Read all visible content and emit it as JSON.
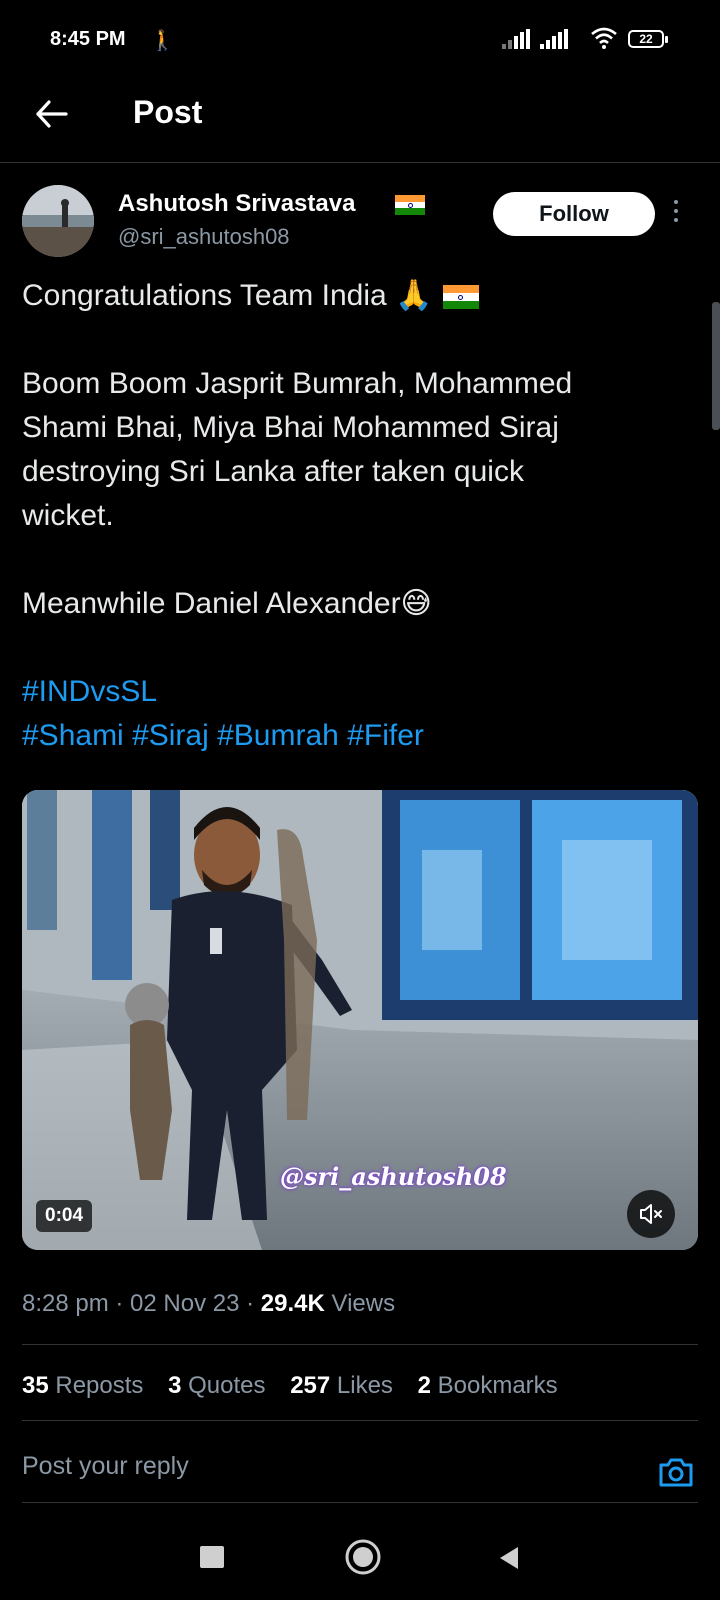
{
  "status_bar": {
    "time": "8:45 PM",
    "battery": "22",
    "icons": [
      "walking-icon",
      "signal-icon",
      "signal-icon",
      "wifi-icon",
      "battery-icon"
    ]
  },
  "header": {
    "title": "Post",
    "back_icon": "arrow-left-icon"
  },
  "post": {
    "author": {
      "name": "Ashutosh Srivastava",
      "handle": "@sri_ashutosh08",
      "flag": "india-flag-icon"
    },
    "follow_label": "Follow",
    "text_lines": [
      "Congratulations Team India 🙏",
      "Boom Boom Jasprit Bumrah, Mohammed",
      "Shami Bhai, Miya Bhai Mohammed Siraj",
      "destroying Sri Lanka after taken quick",
      "wicket.",
      "Meanwhile Daniel Alexander😅"
    ],
    "hashtags": [
      "#INDvsSL",
      "#Shami",
      "#Siraj",
      "#Bumrah",
      "#Fifer"
    ],
    "video": {
      "duration": "0:04",
      "watermark": "@sri_ashutosh08",
      "muted": true
    },
    "time": "8:28 pm",
    "date": "02 Nov 23",
    "views_count": "29.4K",
    "views_label": "Views",
    "stats": [
      {
        "count": "35",
        "label": "Reposts"
      },
      {
        "count": "3",
        "label": "Quotes"
      },
      {
        "count": "257",
        "label": "Likes"
      },
      {
        "count": "2",
        "label": "Bookmarks"
      }
    ]
  },
  "reply": {
    "placeholder": "Post your reply"
  },
  "colors": {
    "background": "#000000",
    "text": "#e7e9ea",
    "secondary": "#8b98a5",
    "link": "#1d9bf0",
    "divider": "#2f3336"
  }
}
